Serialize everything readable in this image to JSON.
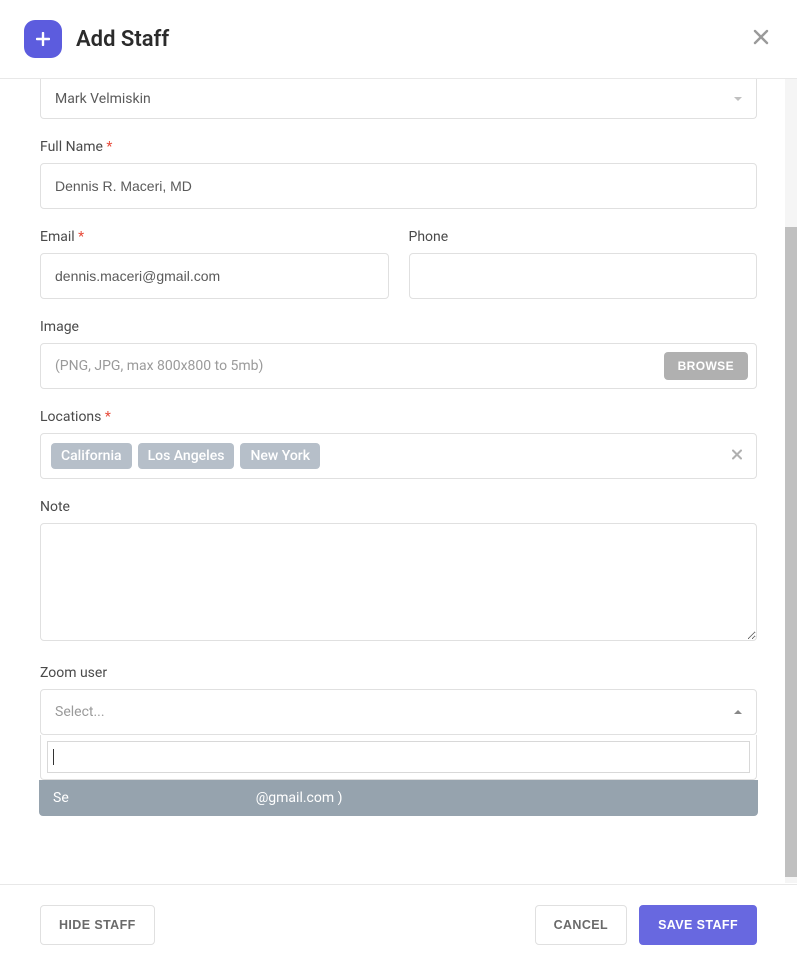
{
  "header": {
    "title": "Add Staff"
  },
  "wp_user": {
    "value": "Mark Velmiskin"
  },
  "full_name": {
    "label": "Full Name",
    "value": "Dennis R. Maceri, MD"
  },
  "email": {
    "label": "Email",
    "value": "dennis.maceri@gmail.com"
  },
  "phone": {
    "label": "Phone",
    "value": ""
  },
  "image": {
    "label": "Image",
    "placeholder": "(PNG, JPG, max 800x800 to 5mb)",
    "browse": "BROWSE"
  },
  "locations": {
    "label": "Locations",
    "tags": [
      "California",
      "Los Angeles",
      "New York"
    ]
  },
  "note": {
    "label": "Note",
    "value": ""
  },
  "zoom": {
    "label": "Zoom user",
    "placeholder": "Select...",
    "option_prefix": "Se",
    "option_suffix": "@gmail.com )"
  },
  "footer": {
    "hide": "HIDE STAFF",
    "cancel": "CANCEL",
    "save": "SAVE STAFF"
  }
}
